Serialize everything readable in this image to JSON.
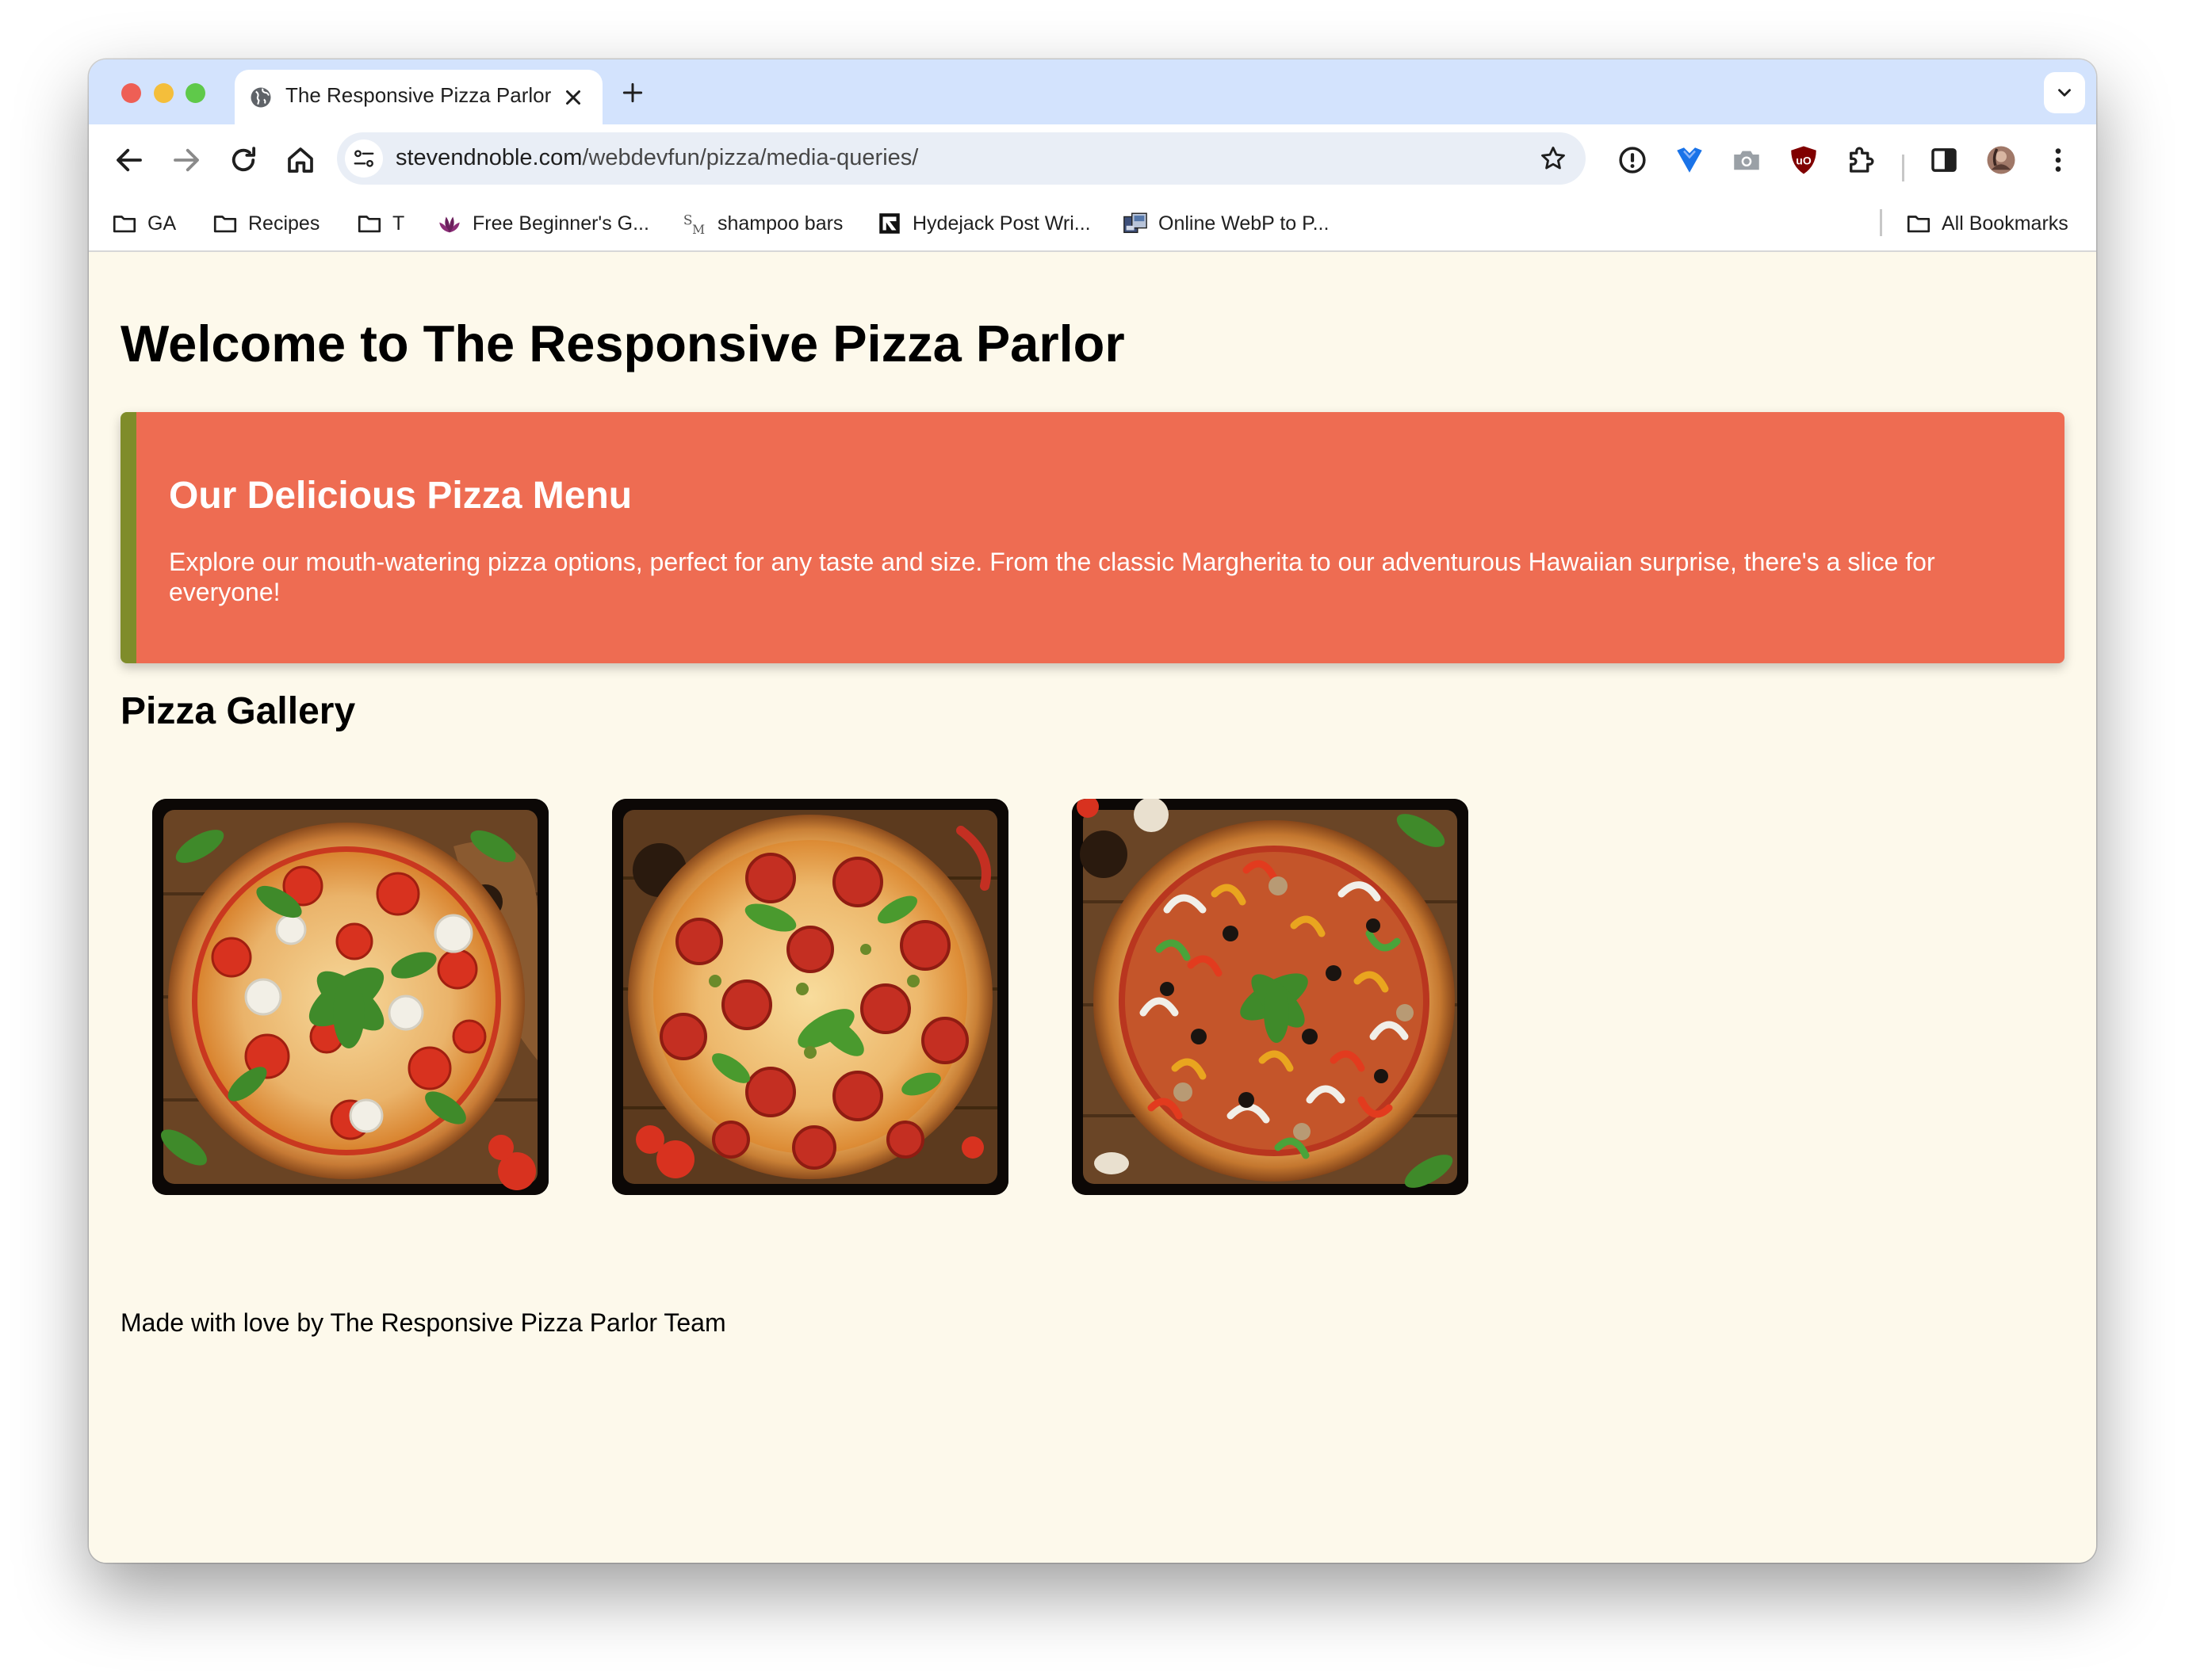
{
  "browser": {
    "tab": {
      "title": "The Responsive Pizza Parlor"
    },
    "address_bar": {
      "host": "stevendnoble.com",
      "path": "/webdevfun/pizza/media-queries/"
    },
    "bookmarks": [
      {
        "label": "GA",
        "icon": "folder-icon"
      },
      {
        "label": "Recipes",
        "icon": "folder-icon"
      },
      {
        "label": "T",
        "icon": "folder-icon"
      },
      {
        "label": "Free Beginner's G...",
        "icon": "leaf-favicon-icon"
      },
      {
        "label": "shampoo bars",
        "icon": "sm-favicon-icon"
      },
      {
        "label": "Hydejack Post Wri...",
        "icon": "hydejack-favicon-icon"
      },
      {
        "label": "Online WebP to P...",
        "icon": "converter-favicon-icon"
      }
    ],
    "all_bookmarks_label": "All Bookmarks",
    "extension_icons": [
      "password-manager-icon",
      "heart-shield-icon",
      "camera-icon",
      "ublock-icon",
      "puzzle-extensions-icon",
      "side-panel-icon",
      "profile-avatar-icon",
      "kebab-menu-icon"
    ]
  },
  "page": {
    "title": "Welcome to The Responsive Pizza Parlor",
    "menu": {
      "heading": "Our Delicious Pizza Menu",
      "description": "Explore our mouth-watering pizza options, perfect for any taste and size. From the classic Margherita to our adventurous Hawaiian surprise, there's a slice for everyone!"
    },
    "gallery": {
      "heading": "Pizza Gallery",
      "images": [
        {
          "name": "margherita-pizza-image"
        },
        {
          "name": "pepperoni-pizza-image"
        },
        {
          "name": "veggie-supreme-pizza-image"
        }
      ]
    },
    "footer": "Made with love by The Responsive Pizza Parlor Team"
  },
  "colors": {
    "page_background": "#fdf9eb",
    "menu_background": "#ee6c52",
    "menu_accent_border": "#7f8c2a",
    "tabstrip": "#d3e3fd",
    "omnibox": "#e9eef6"
  }
}
